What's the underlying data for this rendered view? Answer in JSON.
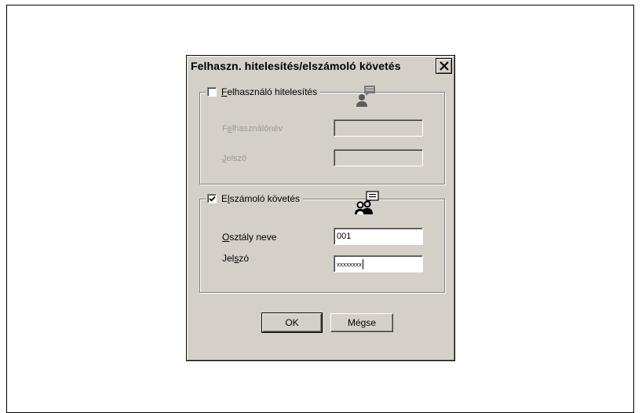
{
  "dialog": {
    "title": "Felhaszn. hitelesítés/elszámoló követés",
    "close_icon": "close-icon"
  },
  "user_auth": {
    "checked": false,
    "label_underline": "F",
    "label_rest": "elhasználó hitelesítés",
    "icon": "user-speech-icon",
    "username_label_a": "F",
    "username_label_u": "e",
    "username_label_b": "lhasználónév",
    "username_value": "",
    "password_label_u": "J",
    "password_label_b": "elszó",
    "password_value": "",
    "enabled": false
  },
  "account_tracking": {
    "checked": true,
    "label_a": "E",
    "label_u": "l",
    "label_b": "számoló követés",
    "icon": "group-speech-icon",
    "department_label_u": "O",
    "department_label_b": "sztály neve",
    "department_value": "001",
    "password_label_a": "Jel",
    "password_label_u": "s",
    "password_label_b": "zó",
    "password_value": "xxxxxxxx",
    "enabled": true
  },
  "buttons": {
    "ok": "OK",
    "cancel": "Mégse"
  },
  "colors": {
    "dialog_bg": "#d4d0c8",
    "disabled_text": "#9a9a9a"
  }
}
